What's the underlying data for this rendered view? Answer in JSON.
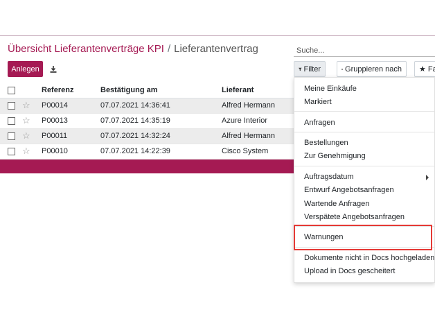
{
  "breadcrumb": {
    "parent": "Übersicht Lieferantenverträge KPI",
    "separator": "/",
    "current": "Lieferantenvertrag"
  },
  "search": {
    "placeholder": "Suche..."
  },
  "toolbar": {
    "create_label": "Anlegen",
    "download_icon": "download-icon"
  },
  "control_buttons": {
    "filter": "Filter",
    "group_by": "Gruppieren nach",
    "favorites": "Fa"
  },
  "table": {
    "columns": [
      "Referenz",
      "Bestätigung am",
      "Lieferant"
    ],
    "rows": [
      {
        "ref": "P00014",
        "date": "07.07.2021 14:36:41",
        "supplier": "Alfred Hermann"
      },
      {
        "ref": "P00013",
        "date": "07.07.2021 14:35:19",
        "supplier": "Azure Interior"
      },
      {
        "ref": "P00011",
        "date": "07.07.2021 14:32:24",
        "supplier": "Alfred Hermann"
      },
      {
        "ref": "P00010",
        "date": "07.07.2021 14:22:39",
        "supplier": "Cisco System"
      }
    ]
  },
  "filter_menu": {
    "items": [
      "Meine Einkäufe",
      "Markiert",
      "Anfragen",
      "Bestellungen",
      "Zur Genehmigung",
      "Auftragsdatum",
      "Entwurf Angebotsanfragen",
      "Wartende Anfragen",
      "Verspätete Angebotsanfragen",
      "Warnungen",
      "Dokumente nicht in Docs hochgeladen",
      "Upload in Docs gescheitert"
    ]
  },
  "colors": {
    "brand": "#a51a53",
    "highlight": "#e53935"
  }
}
